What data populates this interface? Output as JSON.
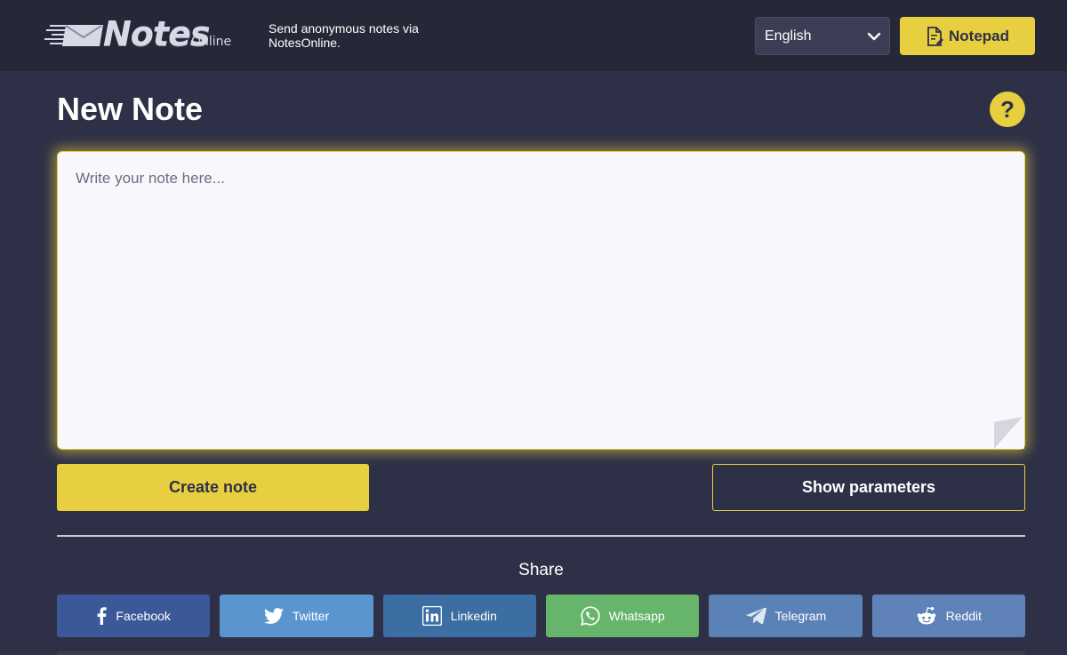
{
  "header": {
    "logo": {
      "word": "Notes",
      "sub": "Online"
    },
    "tagline": "Send anonymous notes via NotesOnline.",
    "language": {
      "selected": "English"
    },
    "notepad_label": "Notepad"
  },
  "main": {
    "title": "New Note",
    "help_label": "?",
    "note": {
      "placeholder": "Write your note here...",
      "value": ""
    },
    "create_label": "Create note",
    "params_label": "Show parameters"
  },
  "share": {
    "label": "Share",
    "buttons": [
      {
        "label": "Facebook",
        "icon": "facebook-icon",
        "color": "#3b5998"
      },
      {
        "label": "Twitter",
        "icon": "twitter-icon",
        "color": "#5b95cf"
      },
      {
        "label": "Linkedin",
        "icon": "linkedin-icon",
        "color": "#3c6ea3"
      },
      {
        "label": "Whatsapp",
        "icon": "whatsapp-icon",
        "color": "#66b56a"
      },
      {
        "label": "Telegram",
        "icon": "telegram-icon",
        "color": "#5b82b6"
      },
      {
        "label": "Reddit",
        "icon": "reddit-icon",
        "color": "#5f82b8"
      }
    ]
  },
  "colors": {
    "background": "#2e3047",
    "header": "#262838",
    "accent": "#e8cf3f"
  }
}
